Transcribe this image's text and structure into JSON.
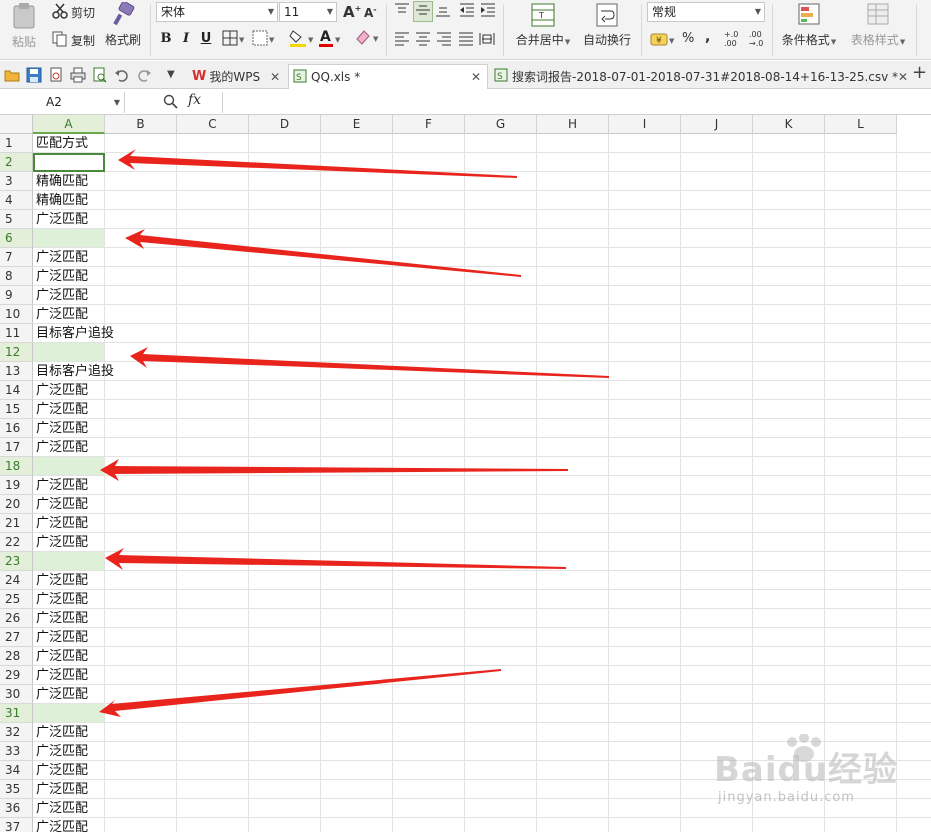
{
  "ribbon": {
    "paste": "粘贴",
    "cut": "剪切",
    "copy": "复制",
    "format_painter": "格式刷",
    "font_name": "宋体",
    "font_size": "11",
    "merge_center": "合并居中",
    "wrap_text": "自动换行",
    "number_format": "常规",
    "conditional_format": "条件格式",
    "table_style": "表格样式",
    "percent": "%",
    "comma": ","
  },
  "tabs": [
    {
      "label": "我的WPS"
    },
    {
      "label": "QQ.xls *"
    },
    {
      "label": "搜索词报告-2018-07-01-2018-07-31#2018-08-14+16-13-25.csv *"
    }
  ],
  "formula_bar": {
    "name_box": "A2",
    "fx": "fx",
    "content": ""
  },
  "columns": [
    "A",
    "B",
    "C",
    "D",
    "E",
    "F",
    "G",
    "H",
    "I",
    "J",
    "K",
    "L"
  ],
  "rows": [
    {
      "num": "1",
      "a": "匹配方式"
    },
    {
      "num": "2",
      "a": ""
    },
    {
      "num": "3",
      "a": "精确匹配"
    },
    {
      "num": "4",
      "a": "精确匹配"
    },
    {
      "num": "5",
      "a": "广泛匹配"
    },
    {
      "num": "6",
      "a": ""
    },
    {
      "num": "7",
      "a": "广泛匹配"
    },
    {
      "num": "8",
      "a": "广泛匹配"
    },
    {
      "num": "9",
      "a": "广泛匹配"
    },
    {
      "num": "10",
      "a": "广泛匹配"
    },
    {
      "num": "11",
      "a": "目标客户追投"
    },
    {
      "num": "12",
      "a": ""
    },
    {
      "num": "13",
      "a": "目标客户追投"
    },
    {
      "num": "14",
      "a": "广泛匹配"
    },
    {
      "num": "15",
      "a": "广泛匹配"
    },
    {
      "num": "16",
      "a": "广泛匹配"
    },
    {
      "num": "17",
      "a": "广泛匹配"
    },
    {
      "num": "18",
      "a": ""
    },
    {
      "num": "19",
      "a": "广泛匹配"
    },
    {
      "num": "20",
      "a": "广泛匹配"
    },
    {
      "num": "21",
      "a": "广泛匹配"
    },
    {
      "num": "22",
      "a": "广泛匹配"
    },
    {
      "num": "23",
      "a": ""
    },
    {
      "num": "24",
      "a": "广泛匹配"
    },
    {
      "num": "25",
      "a": "广泛匹配"
    },
    {
      "num": "26",
      "a": "广泛匹配"
    },
    {
      "num": "27",
      "a": "广泛匹配"
    },
    {
      "num": "28",
      "a": "广泛匹配"
    },
    {
      "num": "29",
      "a": "广泛匹配"
    },
    {
      "num": "30",
      "a": "广泛匹配"
    },
    {
      "num": "31",
      "a": ""
    },
    {
      "num": "32",
      "a": "广泛匹配"
    },
    {
      "num": "33",
      "a": "广泛匹配"
    },
    {
      "num": "34",
      "a": "广泛匹配"
    },
    {
      "num": "35",
      "a": "广泛匹配"
    },
    {
      "num": "36",
      "a": "广泛匹配"
    },
    {
      "num": "37",
      "a": "广泛匹配"
    }
  ],
  "selection": {
    "active_row": "2",
    "highlighted_rows": [
      "2",
      "6",
      "12",
      "18",
      "23",
      "31"
    ],
    "selected_column": "A"
  },
  "watermark": {
    "brand": "Baidu经验",
    "url": "jingyan.baidu.com"
  },
  "colors": {
    "selection_green": "#dff0d8",
    "arrow_red": "#e8241c",
    "header_selected": "#6aa84f"
  }
}
